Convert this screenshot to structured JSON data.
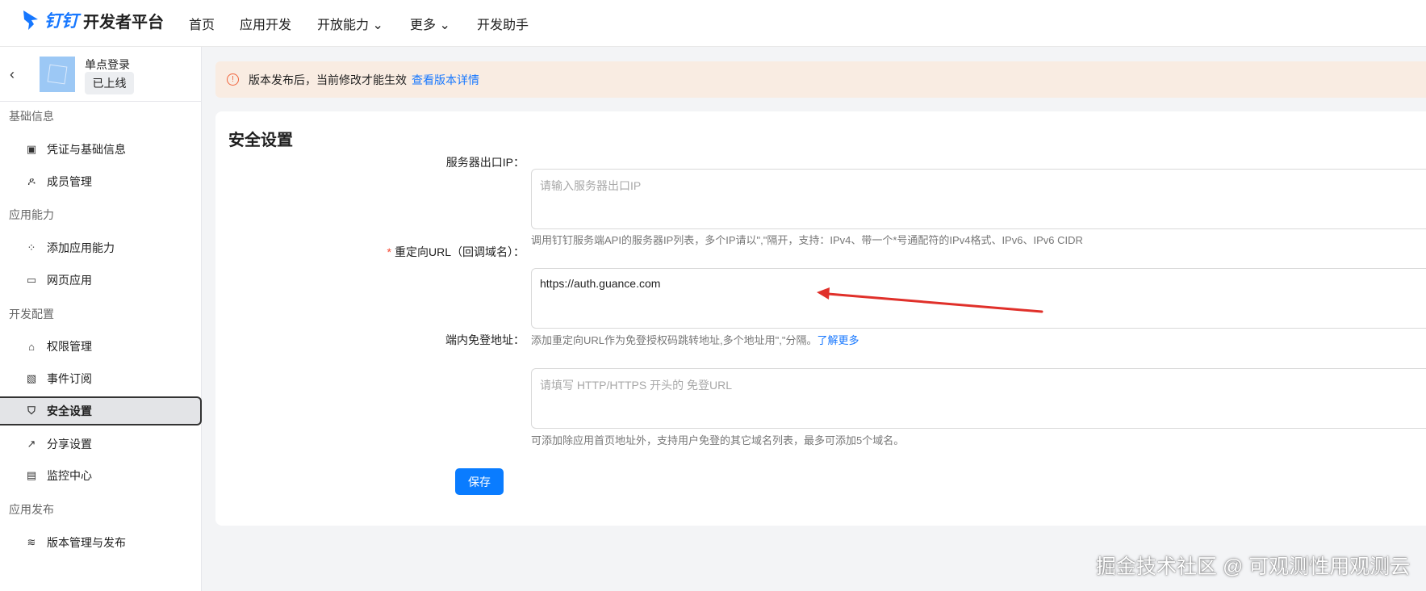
{
  "header": {
    "brand": "钉钉",
    "platform": "开发者平台",
    "nav": [
      {
        "label": "首页"
      },
      {
        "label": "应用开发"
      },
      {
        "label": "开放能力",
        "dropdown": true
      },
      {
        "label": "更多",
        "dropdown": true
      },
      {
        "label": "开发助手"
      }
    ]
  },
  "sidebar": {
    "app_name": "单点登录",
    "app_status": "已上线",
    "sections": [
      {
        "title": "基础信息",
        "items": [
          {
            "label": "凭证与基础信息",
            "icon": "credential-icon"
          },
          {
            "label": "成员管理",
            "icon": "user-icon"
          }
        ]
      },
      {
        "title": "应用能力",
        "items": [
          {
            "label": "添加应用能力",
            "icon": "apps-add-icon"
          },
          {
            "label": "网页应用",
            "icon": "browser-icon"
          }
        ]
      },
      {
        "title": "开发配置",
        "items": [
          {
            "label": "权限管理",
            "icon": "lock-icon"
          },
          {
            "label": "事件订阅",
            "icon": "rss-icon"
          },
          {
            "label": "安全设置",
            "icon": "shield-icon",
            "active": true
          },
          {
            "label": "分享设置",
            "icon": "share-icon"
          },
          {
            "label": "监控中心",
            "icon": "monitor-icon"
          }
        ]
      },
      {
        "title": "应用发布",
        "items": [
          {
            "label": "版本管理与发布",
            "icon": "layers-icon"
          }
        ]
      }
    ]
  },
  "notice": {
    "text": "版本发布后，当前修改才能生效",
    "link": "查看版本详情"
  },
  "form": {
    "title": "安全设置",
    "server_ip": {
      "label": "服务器出口IP：",
      "placeholder": "请输入服务器出口IP",
      "value": "",
      "help": "调用钉钉服务端API的服务器IP列表，多个IP请以\",\"隔开，支持：IPv4、带一个*号通配符的IPv4格式、IPv6、IPv6 CIDR"
    },
    "redirect_url": {
      "required_mark": "*",
      "label": "重定向URL（回调域名）：",
      "value": "https://auth.guance.com",
      "help": "添加重定向URL作为免登授权码跳转地址,多个地址用\",\"分隔。",
      "help_link": "了解更多"
    },
    "sso_url": {
      "label": "端内免登地址：",
      "placeholder": "请填写 HTTP/HTTPS 开头的 免登URL",
      "value": "",
      "help": "可添加除应用首页地址外，支持用户免登的其它域名列表，最多可添加5个域名。"
    },
    "save_label": "保存"
  },
  "watermark": "掘金技术社区 @ 可观测性用观测云",
  "colors": {
    "accent": "#0a7cff",
    "notice_bg": "#f9ece2",
    "annotation_arrow": "#e0302a"
  }
}
